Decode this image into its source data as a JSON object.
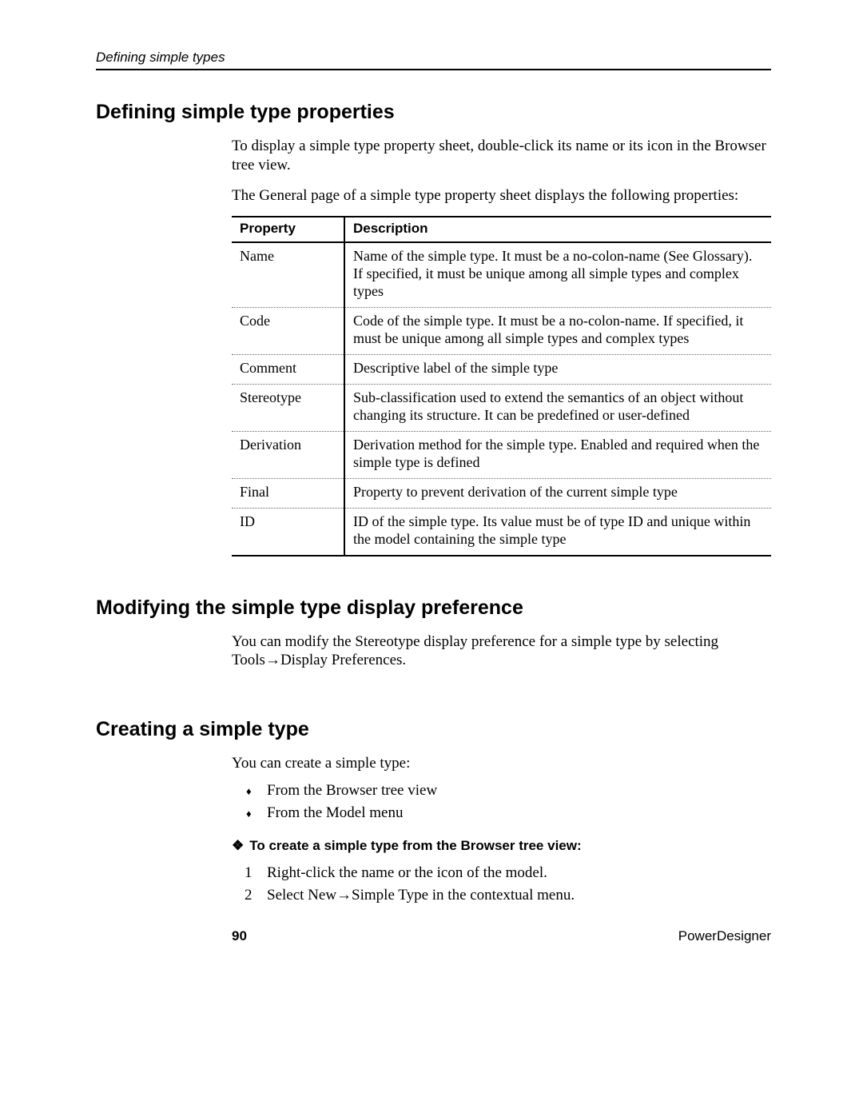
{
  "running_head": "Defining simple types",
  "section1": {
    "heading": "Defining simple type properties",
    "para1": "To display a simple type property sheet, double-click its name or its icon in the Browser tree view.",
    "para2": "The General page of a simple type property sheet displays the following properties:",
    "table": {
      "head_property": "Property",
      "head_description": "Description",
      "rows": [
        {
          "property": "Name",
          "description": "Name of the simple type. It must be a no-colon-name (See Glossary). If specified, it must be unique among all simple types and complex types"
        },
        {
          "property": "Code",
          "description": "Code of the simple type. It must be a no-colon-name. If specified, it must be unique among all simple types and complex types"
        },
        {
          "property": "Comment",
          "description": "Descriptive label of the simple type"
        },
        {
          "property": "Stereotype",
          "description": "Sub-classification used to extend the semantics of an object without changing its structure. It can be predefined or user-defined"
        },
        {
          "property": "Derivation",
          "description": "Derivation method for the simple type. Enabled and required when the simple type is defined"
        },
        {
          "property": "Final",
          "description": "Property to prevent derivation of the current simple type"
        },
        {
          "property": "ID",
          "description": "ID of the simple type. Its value must be of type ID and unique within the model containing the simple type"
        }
      ]
    }
  },
  "section2": {
    "heading": "Modifying the simple type display preference",
    "para": "You can modify the Stereotype display preference for a simple type by selecting Tools→Display Preferences."
  },
  "section3": {
    "heading": "Creating a simple type",
    "intro": "You can create a simple type:",
    "bullets": [
      "From the Browser tree view",
      "From the Model menu"
    ],
    "proc_head": "To create a simple type from the Browser tree view:",
    "steps": [
      "Right-click the name or the icon of the model.",
      "Select New→Simple Type in the contextual menu."
    ]
  },
  "footer": {
    "page_number": "90",
    "product": "PowerDesigner"
  }
}
